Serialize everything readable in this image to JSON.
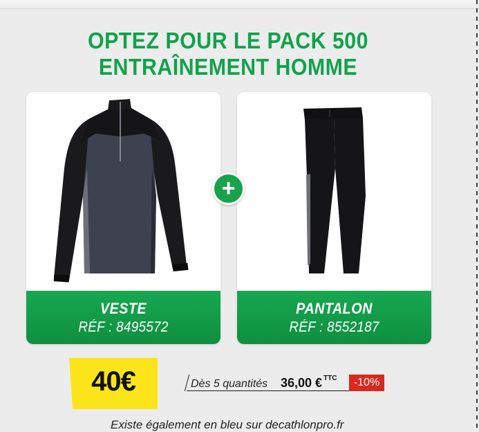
{
  "headline": {
    "line1": "OPTEZ POUR LE PACK 500",
    "line2": "ENTRAÎNEMENT HOMME"
  },
  "products": [
    {
      "name": "VESTE",
      "ref": "RÉF : 8495572",
      "image_icon": "training-jacket-icon"
    },
    {
      "name": "PANTALON",
      "ref": "RÉF : 8552187",
      "image_icon": "training-pants-icon"
    }
  ],
  "plus": {
    "label": "+",
    "icon": "plus-icon"
  },
  "price": {
    "label": "40€"
  },
  "bulk": {
    "label": "Dès 5 quantités",
    "price": "36,00 €",
    "tax": "TTC",
    "discount": "-10%"
  },
  "footer": {
    "text": "Existe également en bleu sur decathlonpro.fr"
  },
  "colors": {
    "brand_green": "#11a24b",
    "band_green": "#17a850",
    "price_yellow": "#fbe51a",
    "discount_red": "#d9281f"
  }
}
